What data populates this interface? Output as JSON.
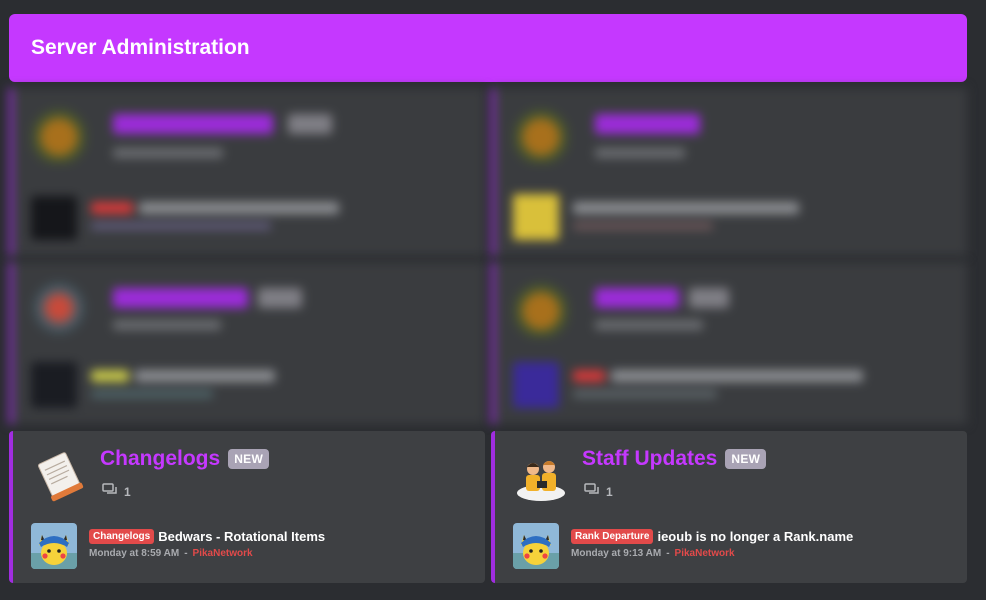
{
  "header": {
    "title": "Server Administration"
  },
  "colors": {
    "accent": "#c538ff",
    "new_badge": "#a9a3b5",
    "author": "#e24a4a"
  },
  "forums": [
    {
      "title": "Changelogs",
      "badge": "NEW",
      "thread_count": "1",
      "icon": "document-icon",
      "latest": {
        "prefix": "Changelogs",
        "prefix_color": "#e24a4a",
        "title": "Bedwars - Rotational Items",
        "time": "Monday at 8:59 AM",
        "separator": "-",
        "author": "PikaNetwork"
      }
    },
    {
      "title": "Staff Updates",
      "badge": "NEW",
      "thread_count": "1",
      "icon": "staff-group-icon",
      "latest": {
        "prefix": "Rank Departure",
        "prefix_color": "#e24a4a",
        "title": "ieoub is no longer a Rank.name",
        "time": "Monday at 9:13 AM",
        "separator": "-",
        "author": "PikaNetwork"
      }
    }
  ]
}
